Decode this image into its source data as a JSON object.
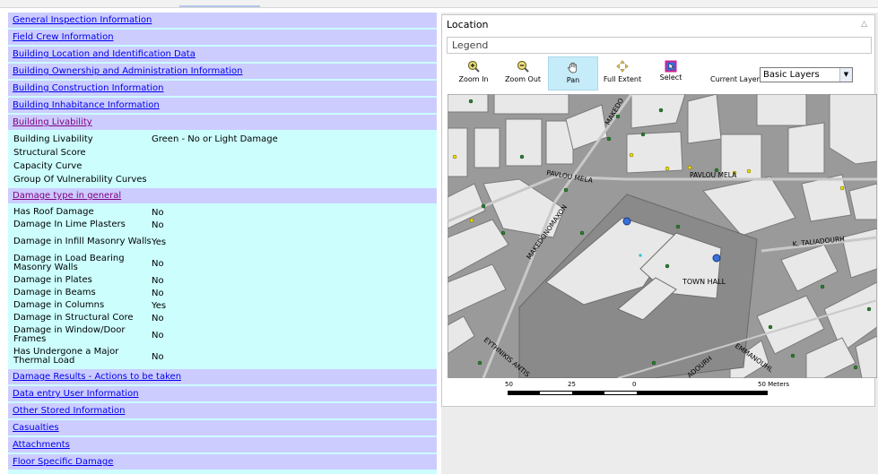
{
  "sections": {
    "general_inspection": "General Inspection Information",
    "field_crew": "Field Crew Information",
    "building_location": "Building Location and Identification Data",
    "building_ownership": "Building Ownership and Administration Information",
    "building_construction": "Building Construction Information",
    "building_inhabitance": "Building Inhabitance Information",
    "building_livability": "Building Livability",
    "damage_type": "Damage type in general",
    "damage_results": "Damage Results - Actions to be taken",
    "data_entry_user": "Data entry User Information",
    "other_stored": "Other Stored Information",
    "casualties": "Casualties",
    "attachments": "Attachments",
    "floor_specific": "Floor Specific Damage"
  },
  "livability": [
    {
      "label": "Building Livability",
      "value": "Green - No or Light Damage"
    },
    {
      "label": "Structural Score",
      "value": ""
    },
    {
      "label": "Capacity Curve",
      "value": ""
    },
    {
      "label": "Group Of Vulnerability Curves",
      "value": ""
    }
  ],
  "damage": [
    {
      "label": "Has Roof Damage",
      "value": "No"
    },
    {
      "label": "Damage In Lime Plasters",
      "value": "No"
    },
    {
      "label": "Damage in Infill Masonry Walls",
      "value": "Yes"
    },
    {
      "label": "Damage in Load Bearing Masonry Walls",
      "value": "No"
    },
    {
      "label": "Damage in Plates",
      "value": "No"
    },
    {
      "label": "Damage in Beams",
      "value": "No"
    },
    {
      "label": "Damage in Columns",
      "value": "Yes"
    },
    {
      "label": "Damage in Structural Core",
      "value": "No"
    },
    {
      "label": "Damage in Window/Door Frames",
      "value": "No"
    },
    {
      "label": "Has Undergone a Major Thermal Load",
      "value": "No"
    }
  ],
  "location": {
    "title": "Location",
    "legend": "Legend",
    "tools": {
      "zoom_in": "Zoom In",
      "zoom_out": "Zoom Out",
      "pan": "Pan",
      "full_extent": "Full Extent",
      "select": "Select"
    },
    "active_tool": "pan",
    "current_layer_label": "Current Layer",
    "current_layer_value": "Basic Layers"
  },
  "map": {
    "streets": [
      "PAVLOU MELA",
      "PAVLOU MELA",
      "MAKEDONOMAXON",
      "MAKEDO",
      "K. TALIADOURH",
      "EYTHNIKIS ANTIS",
      "EMMANOUHL",
      "ADOURH"
    ],
    "landmark": "TOWN HALL"
  },
  "scalebar": {
    "ticks": [
      "50",
      "25",
      "0",
      "50 Meters"
    ]
  },
  "colors": {
    "panel_bg": "#ccfefe",
    "header_bg": "#ccccff",
    "link": "#0000ee",
    "visited": "#800080",
    "pan_active": "#c6ecfa"
  }
}
